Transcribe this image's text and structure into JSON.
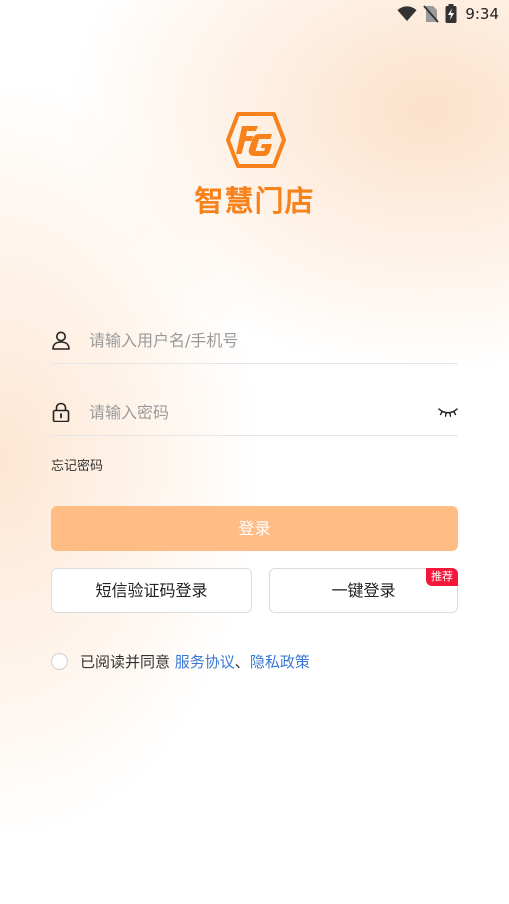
{
  "status_bar": {
    "time": "9:34",
    "icons": [
      "wifi-icon",
      "no-sim-icon",
      "battery-charging-icon"
    ]
  },
  "brand": {
    "logo_icon": "fg-hexagon-logo-icon",
    "app_name": "智慧门店",
    "accent_color": "#f7811a"
  },
  "login_form": {
    "username_placeholder": "请输入用户名/手机号",
    "username_value": "",
    "password_placeholder": "请输入密码",
    "password_value": "",
    "forgot_password": "忘记密码",
    "login_button": "登录"
  },
  "alt_login": {
    "sms_login": "短信验证码登录",
    "one_key_login": "一键登录",
    "recommend_badge": "推荐"
  },
  "agreement": {
    "checked": false,
    "prefix": "已阅读并同意 ",
    "service_agreement": "服务协议",
    "separator": "、",
    "privacy_policy": "隐私政策"
  }
}
